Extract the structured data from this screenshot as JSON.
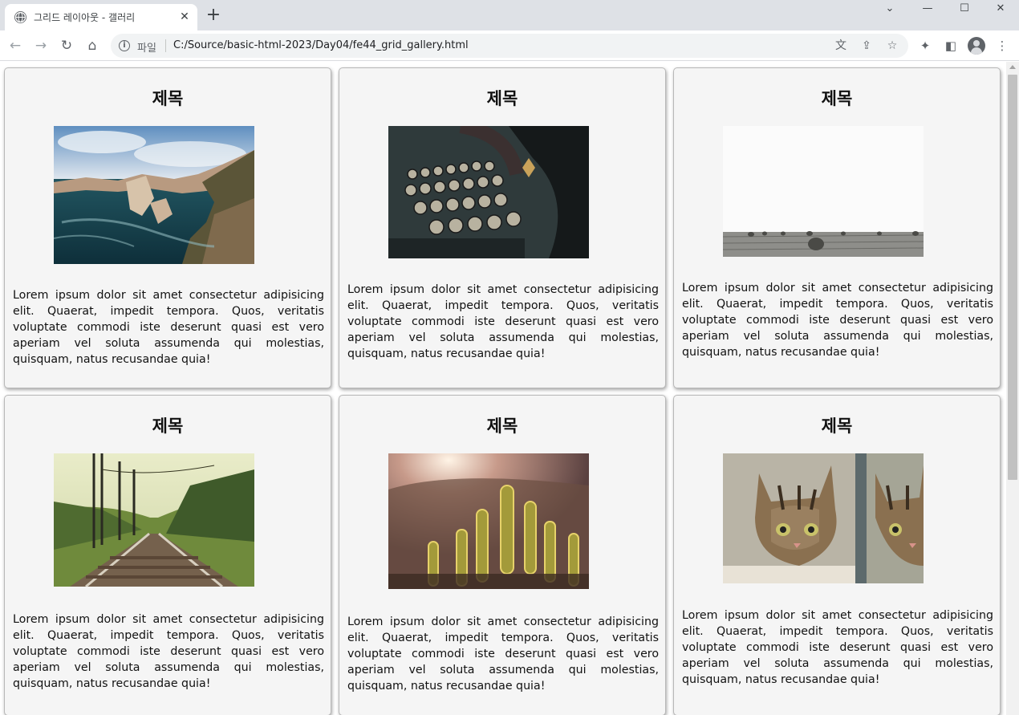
{
  "browser": {
    "tab_title": "그리드 레이아웃 - 갤러리",
    "new_tab_label": "+",
    "scheme_label": "파일",
    "url": "C:/Source/basic-html-2023/Day04/fe44_grid_gallery.html",
    "icons": {
      "favicon": "globe-icon",
      "close": "close-icon",
      "back": "back-arrow-icon",
      "forward": "forward-arrow-icon",
      "reload": "reload-icon",
      "home": "home-icon",
      "info": "info-icon",
      "translate": "translate-icon",
      "share": "share-icon",
      "bookmark": "star-icon",
      "extensions": "puzzle-icon",
      "sidepanel": "side-panel-icon",
      "profile": "profile-avatar-icon",
      "menu": "kebab-menu-icon"
    }
  },
  "gallery": {
    "cards": [
      {
        "title": "제목",
        "image": "coastal-cliffs-photo",
        "text": "Lorem ipsum dolor sit amet consectetur adipisicing elit. Quaerat, impedit tempora. Quos, veritatis voluptate commodi iste deserunt quasi est vero aperiam vel soluta assumenda qui molestias, quisquam, natus recusandae quia!"
      },
      {
        "title": "제목",
        "image": "typewriter-photo",
        "text": "Lorem ipsum dolor sit amet consectetur adipisicing elit. Quaerat, impedit tempora. Quos, veritatis voluptate commodi iste deserunt quasi est vero aperiam vel soluta assumenda qui molestias, quisquam, natus recusandae quia!"
      },
      {
        "title": "제목",
        "image": "hay-bales-field-photo",
        "text": "Lorem ipsum dolor sit amet consectetur adipisicing elit. Quaerat, impedit tempora. Quos, veritatis voluptate commodi iste deserunt quasi est vero aperiam vel soluta assumenda qui molestias, quisquam, natus recusandae quia!"
      },
      {
        "title": "제목",
        "image": "railway-tracks-photo",
        "text": "Lorem ipsum dolor sit amet consectetur adipisicing elit. Quaerat, impedit tempora. Quos, veritatis voluptate commodi iste deserunt quasi est vero aperiam vel soluta assumenda qui molestias, quisquam, natus recusandae quia!"
      },
      {
        "title": "제목",
        "image": "cactus-sunset-photo",
        "text": "Lorem ipsum dolor sit amet consectetur adipisicing elit. Quaerat, impedit tempora. Quos, veritatis voluptate commodi iste deserunt quasi est vero aperiam vel soluta assumenda qui molestias, quisquam, natus recusandae quia!"
      },
      {
        "title": "제목",
        "image": "kitten-mirror-photo",
        "text": "Lorem ipsum dolor sit amet consectetur adipisicing elit. Quaerat, impedit tempora. Quos, veritatis voluptate commodi iste deserunt quasi est vero aperiam vel soluta assumenda qui molestias, quisquam, natus recusandae quia!"
      }
    ]
  },
  "colors": {
    "tabstrip": "#dee1e6",
    "card_bg": "#f5f5f5",
    "card_border": "#b8b8b8"
  }
}
